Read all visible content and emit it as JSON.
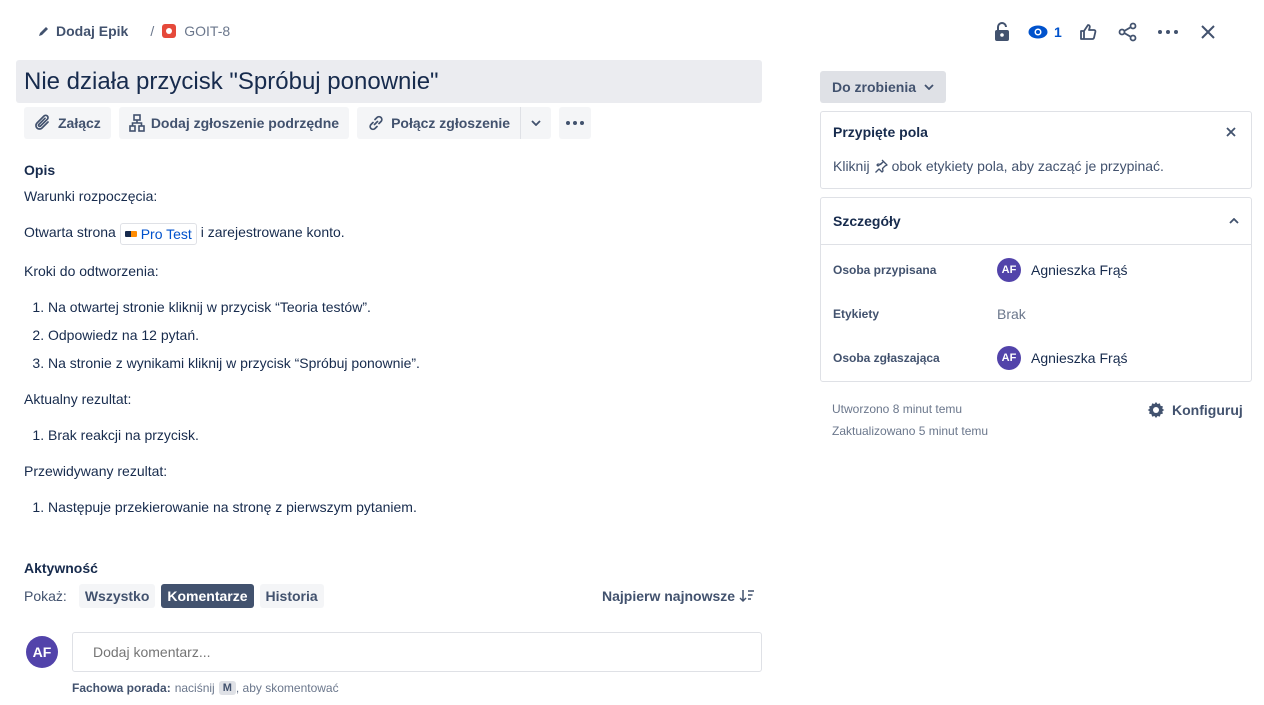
{
  "breadcrumb": {
    "epic_label": "Dodaj Epik",
    "separator": "/",
    "issue_key": "GOIT-8"
  },
  "toolbar": {
    "watchers_count": "1"
  },
  "issue": {
    "title": "Nie działa przycisk \"Spróbuj ponownie\""
  },
  "actions": {
    "attach": "Załącz",
    "add_child": "Dodaj zgłoszenie podrzędne",
    "link_issue": "Połącz zgłoszenie"
  },
  "description": {
    "heading": "Opis",
    "preconditions_label": "Warunki rozpoczęcia:",
    "precondition_before": "Otwarta strona",
    "precondition_link": "Pro Test",
    "precondition_after": "i zarejestrowane konto.",
    "steps_label": "Kroki do odtworzenia:",
    "steps": [
      "Na otwartej stronie kliknij w przycisk “Teoria testów”.",
      "Odpowiedz na 12 pytań.",
      "Na stronie z wynikami kliknij w przycisk “Spróbuj ponownie”."
    ],
    "actual_label": "Aktualny rezultat:",
    "actual": [
      "Brak reakcji na przycisk."
    ],
    "expected_label": "Przewidywany rezultat:",
    "expected": [
      "Następuje przekierowanie na stronę z pierwszym pytaniem."
    ]
  },
  "activity": {
    "title": "Aktywność",
    "show_label": "Pokaż:",
    "filters": [
      "Wszystko",
      "Komentarze",
      "Historia"
    ],
    "active_filter": "Komentarze",
    "sort_label": "Najpierw najnowsze",
    "user_initials": "AF",
    "comment_placeholder": "Dodaj komentarz...",
    "tip_bold": "Fachowa porada:",
    "tip_before": "naciśnij",
    "tip_key": "M",
    "tip_after": ", aby skomentować"
  },
  "sidebar": {
    "status": "Do zrobienia",
    "pinned": {
      "title": "Przypięte pola",
      "text_before": "Kliknij",
      "text_after": "obok etykiety pola, aby zacząć je przypinać."
    },
    "details": {
      "title": "Szczegóły",
      "assignee_label": "Osoba przypisana",
      "assignee_initials": "AF",
      "assignee_name": "Agnieszka Frąś",
      "labels_label": "Etykiety",
      "labels_value": "Brak",
      "reporter_label": "Osoba zgłaszająca",
      "reporter_initials": "AF",
      "reporter_name": "Agnieszka Frąś"
    },
    "created": "Utworzono 8 minut temu",
    "updated": "Zaktualizowano 5 minut temu",
    "configure": "Konfiguruj"
  },
  "colors": {
    "avatar": "#5243aa",
    "link": "#0052cc",
    "bug": "#e5493a"
  }
}
